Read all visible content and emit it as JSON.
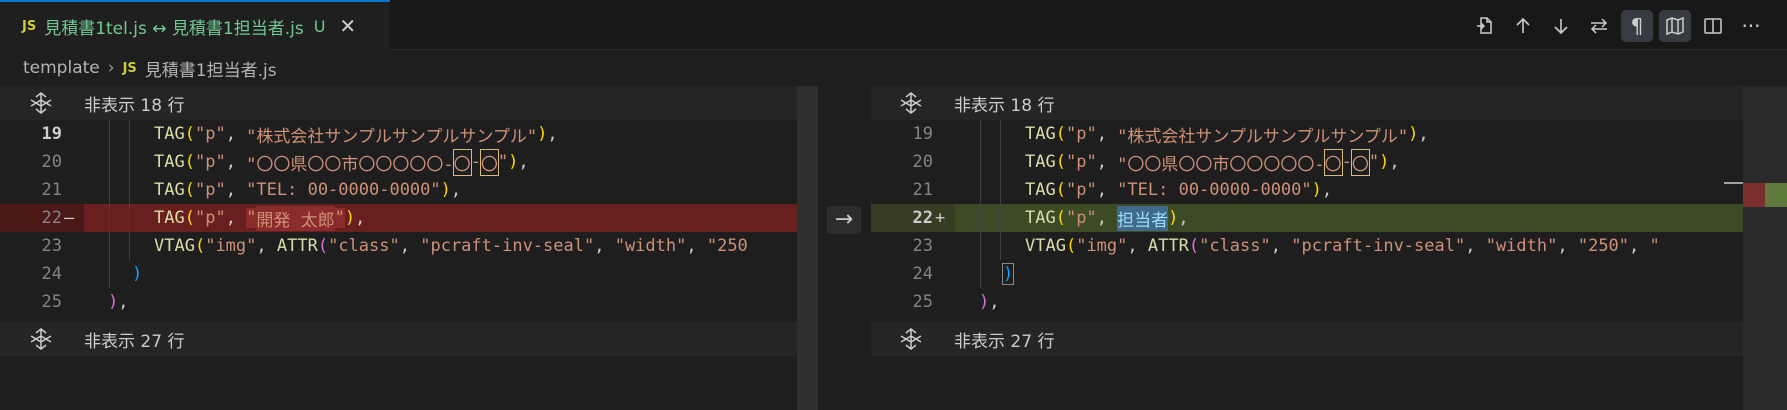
{
  "tab": {
    "badge": "JS",
    "title": "見積書1tel.js ↔ 見積書1担当者.js",
    "modified": "U",
    "close": "✕"
  },
  "breadcrumb": {
    "folder": "template",
    "badge": "JS",
    "file": "見積書1担当者.js"
  },
  "hidden": {
    "top": "非表示 18 行",
    "bottom": "非表示 27 行"
  },
  "arrow": "→",
  "left": {
    "lines": [
      {
        "n": "19",
        "marker": "",
        "code": "TAG(\"p\", \"株式会社サンプルサンプルサンプル\"),"
      },
      {
        "n": "20",
        "marker": "",
        "code": "TAG(\"p\", \"〇〇県〇〇市〇〇〇〇〇-〇-〇\"),"
      },
      {
        "n": "21",
        "marker": "",
        "code": "TAG(\"p\", \"TEL: 00-0000-0000\"),"
      },
      {
        "n": "22",
        "marker": "—",
        "code": "TAG(\"p\", \"開発 太郎\"),"
      },
      {
        "n": "23",
        "marker": "",
        "code": "VTAG(\"img\", ATTR(\"class\", \"pcraft-inv-seal\", \"width\", \"250"
      },
      {
        "n": "24",
        "marker": "",
        "code": ")"
      },
      {
        "n": "25",
        "marker": "",
        "code": "),"
      }
    ]
  },
  "right": {
    "lines": [
      {
        "n": "19",
        "marker": "",
        "code": "TAG(\"p\", \"株式会社サンプルサンプルサンプル\"),"
      },
      {
        "n": "20",
        "marker": "",
        "code": "TAG(\"p\", \"〇〇県〇〇市〇〇〇〇〇-〇-〇\"),"
      },
      {
        "n": "21",
        "marker": "",
        "code": "TAG(\"p\", \"TEL: 00-0000-0000\"),"
      },
      {
        "n": "22",
        "marker": "+",
        "code": "TAG(\"p\", 担当者),"
      },
      {
        "n": "23",
        "marker": "",
        "code": "VTAG(\"img\", ATTR(\"class\", \"pcraft-inv-seal\", \"width\", \"250\", \""
      },
      {
        "n": "24",
        "marker": "",
        "code": ")"
      },
      {
        "n": "25",
        "marker": "",
        "code": "),"
      }
    ]
  },
  "tokens": {
    "tag": "TAG",
    "vtag": "VTAG",
    "attr": "ATTR",
    "p": "\"p\"",
    "comma": ", ",
    "s_company": "\"株式会社サンプルサンプルサンプル\"",
    "s_addr_a": "\"〇〇県〇〇市〇〇〇〇〇-",
    "s_addr_b": "〇",
    "s_addr_c": "-",
    "s_addr_d": "〇",
    "s_addr_e": "\"",
    "s_tel": "\"TEL: 00-0000-0000\"",
    "q": "\"",
    "s_name": "開発 太郎",
    "v_tantou": "担当者",
    "s_img": "\"img\"",
    "s_class": "\"class\"",
    "s_seal": "\"pcraft-inv-seal\"",
    "s_width": "\"width\"",
    "s_250_cut": "\"250",
    "s_250": "\"250\"",
    "s_tail": "\""
  },
  "colors": {
    "accent": "#0078d4",
    "deleted_bg": "#6a1f1f",
    "inserted_bg": "#3c4a25",
    "untracked": "#73c991",
    "js_badge": "#cbcb41"
  },
  "toolbar_icons": [
    "open-file-icon",
    "arrow-up-icon",
    "arrow-down-icon",
    "swap-icon",
    "pilcrow-icon",
    "map-icon",
    "split-editor-icon",
    "more-icon"
  ],
  "toolbar": {
    "pilcrow": "¶",
    "more": "···"
  }
}
